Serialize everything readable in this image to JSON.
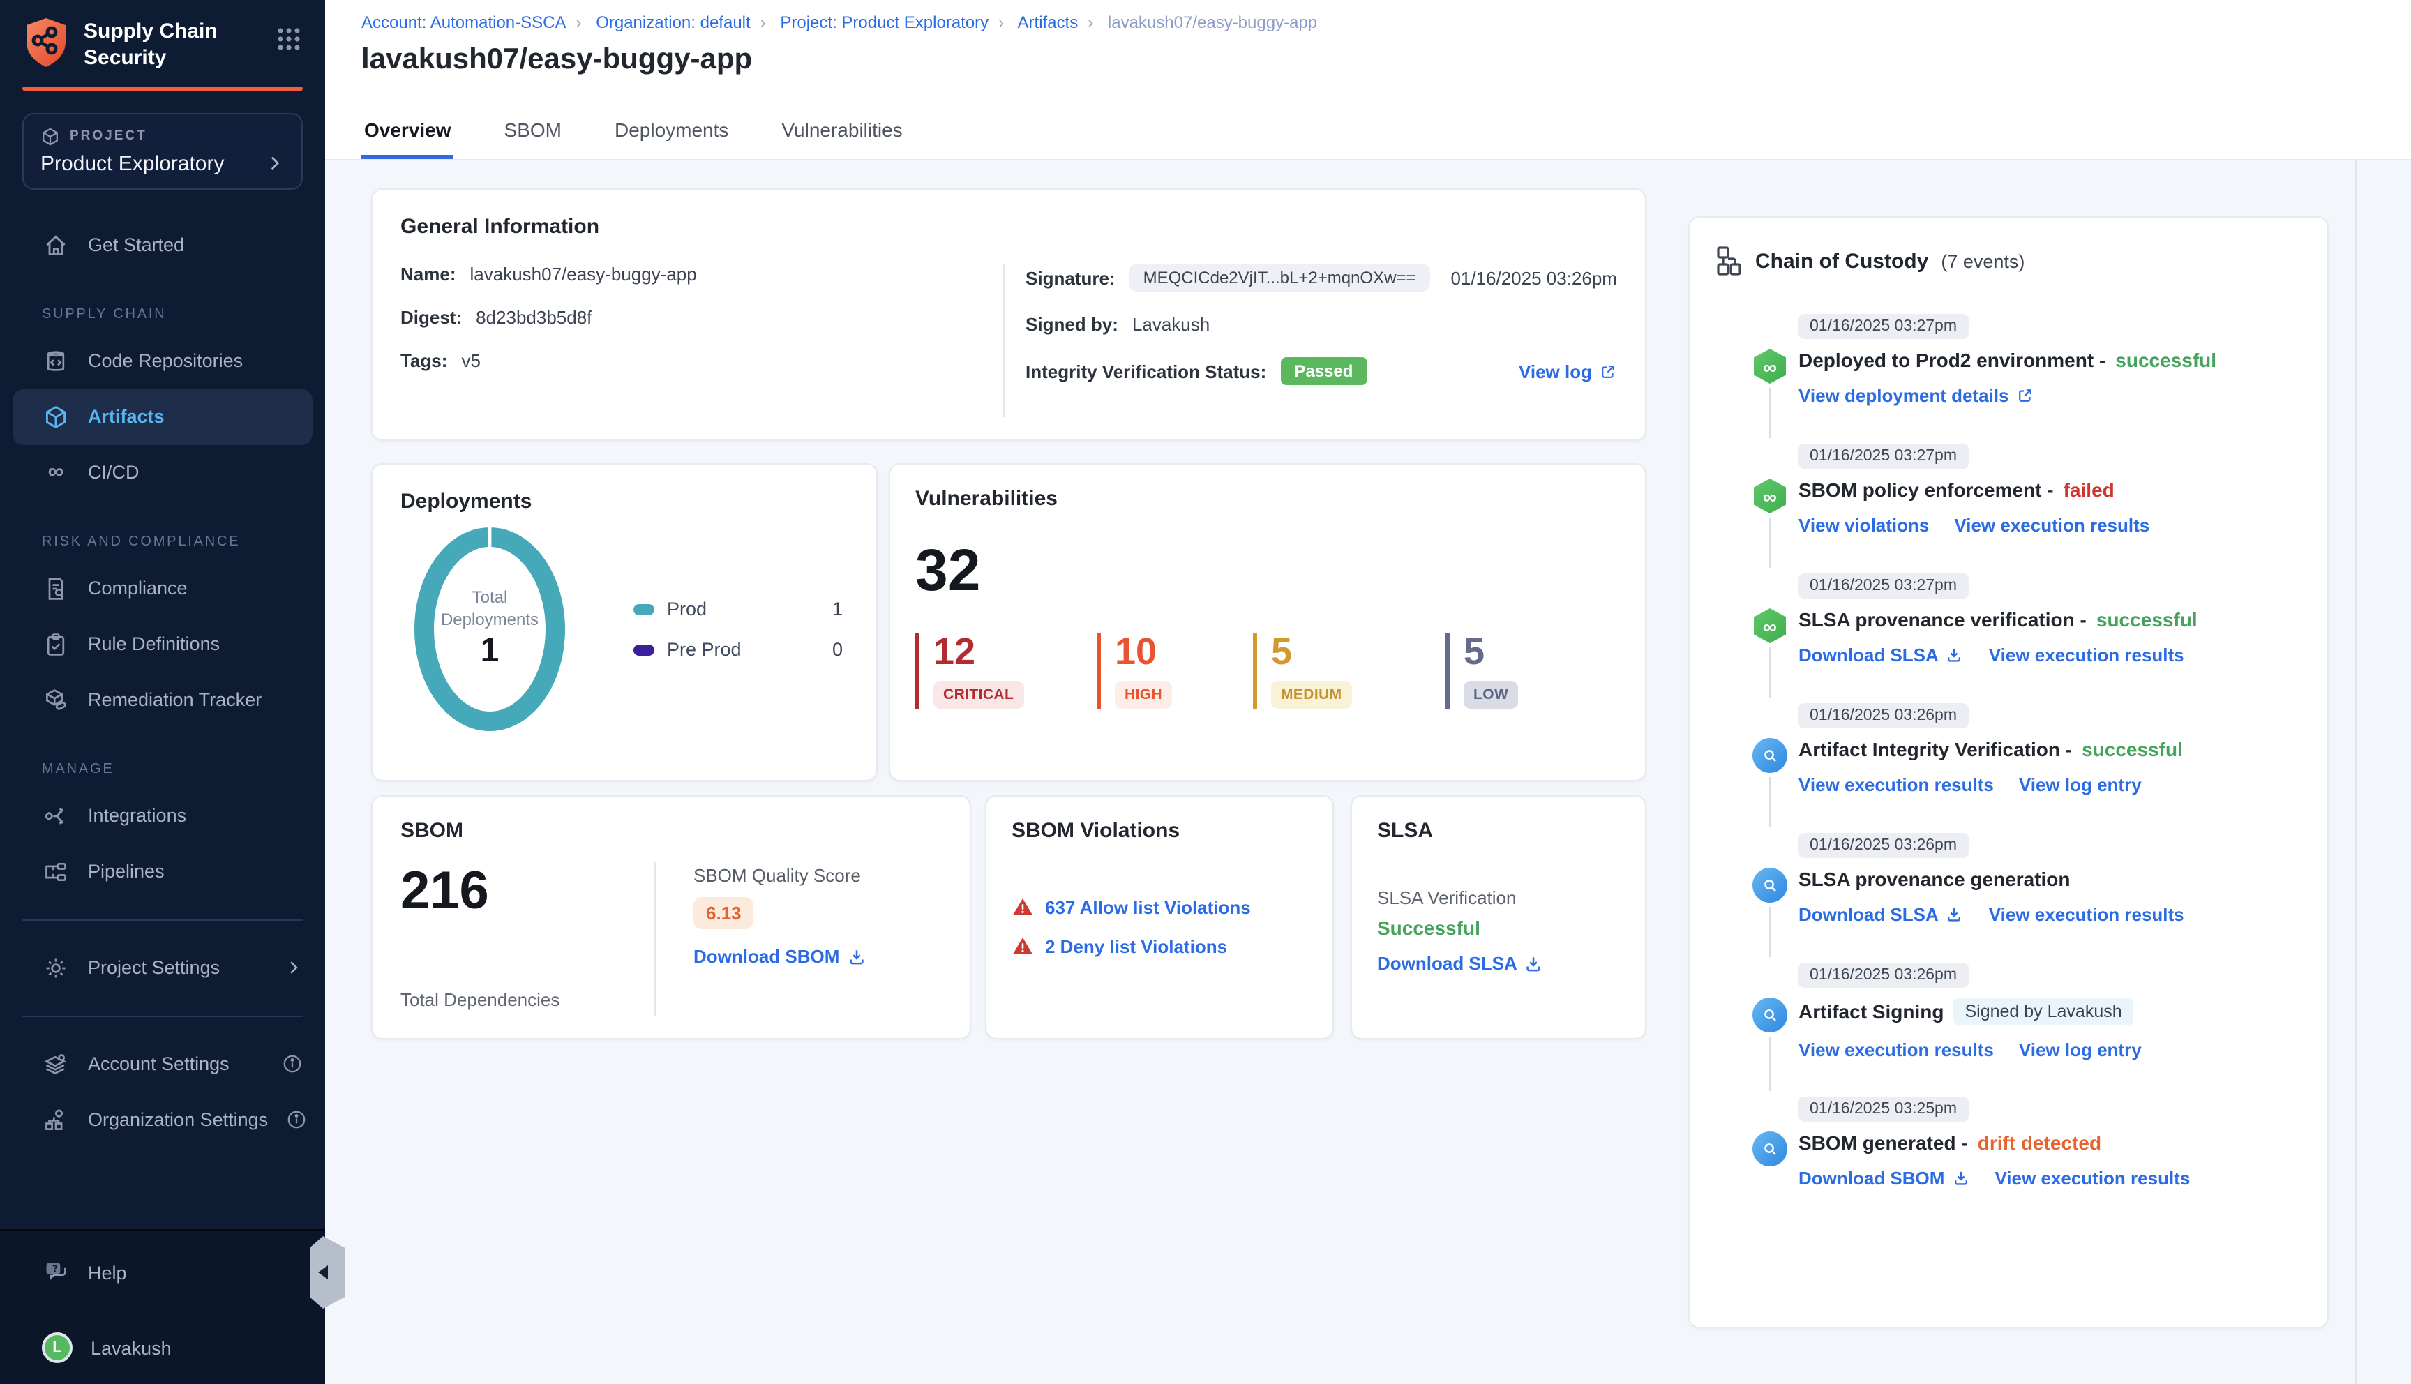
{
  "brand": {
    "title": "Supply Chain Security",
    "accent_color": "#f25c3f"
  },
  "sidebar": {
    "project": {
      "label": "PROJECT",
      "name": "Product Exploratory"
    },
    "get_started": "Get Started",
    "sections": [
      {
        "label": "SUPPLY CHAIN",
        "items": [
          {
            "label": "Code Repositories"
          },
          {
            "label": "Artifacts",
            "active": true
          },
          {
            "label": "CI/CD"
          }
        ]
      },
      {
        "label": "RISK AND COMPLIANCE",
        "items": [
          {
            "label": "Compliance"
          },
          {
            "label": "Rule Definitions"
          },
          {
            "label": "Remediation Tracker"
          }
        ]
      },
      {
        "label": "MANAGE",
        "items": [
          {
            "label": "Integrations"
          },
          {
            "label": "Pipelines"
          }
        ]
      }
    ],
    "project_settings": "Project Settings",
    "account_settings": "Account Settings",
    "organization_settings": "Organization Settings",
    "help": "Help",
    "user": {
      "name": "Lavakush",
      "initial": "L"
    }
  },
  "header": {
    "breadcrumb": [
      {
        "label": "Account: Automation-SSCA"
      },
      {
        "label": "Organization: default"
      },
      {
        "label": "Project: Product Exploratory"
      },
      {
        "label": "Artifacts"
      },
      {
        "label": "lavakush07/easy-buggy-app"
      }
    ],
    "title": "lavakush07/easy-buggy-app",
    "tabs": [
      {
        "label": "Overview",
        "active": true
      },
      {
        "label": "SBOM"
      },
      {
        "label": "Deployments"
      },
      {
        "label": "Vulnerabilities"
      }
    ]
  },
  "general_info": {
    "title": "General Information",
    "name_label": "Name:",
    "name": "lavakush07/easy-buggy-app",
    "digest_label": "Digest:",
    "digest": "8d23bd3b5d8f",
    "tags_label": "Tags:",
    "tags": "v5",
    "signature_label": "Signature:",
    "signature": "MEQCICde2VjIT...bL+2+mqnOXw==",
    "signature_time": "01/16/2025 03:26pm",
    "signed_by_label": "Signed by:",
    "signed_by": "Lavakush",
    "integrity_label": "Integrity Verification Status:",
    "integrity_status": "Passed",
    "view_log": "View log"
  },
  "deployments": {
    "title": "Deployments",
    "donut": {
      "center_label_1": "Total",
      "center_label_2": "Deployments",
      "total": "1",
      "color": "#45a9ba"
    },
    "legend": [
      {
        "label": "Prod",
        "value": "1",
        "color": "#45a9ba"
      },
      {
        "label": "Pre Prod",
        "value": "0",
        "color": "#3c1f9b"
      }
    ]
  },
  "vulnerabilities": {
    "title": "Vulnerabilities",
    "total": "32",
    "severities": [
      {
        "label": "CRITICAL",
        "count": "12",
        "color": "#b32b2e"
      },
      {
        "label": "HIGH",
        "count": "10",
        "color": "#e8542f"
      },
      {
        "label": "MEDIUM",
        "count": "5",
        "color": "#d29a2e"
      },
      {
        "label": "LOW",
        "count": "5",
        "color": "#646c8a"
      }
    ]
  },
  "sbom": {
    "title": "SBOM",
    "total": "216",
    "total_label": "Total Dependencies",
    "quality_label": "SBOM Quality Score",
    "quality_score": "6.13",
    "download": "Download SBOM"
  },
  "sbom_violations": {
    "title": "SBOM Violations",
    "rows": [
      {
        "label": "637 Allow list Violations"
      },
      {
        "label": "2 Deny list Violations"
      }
    ]
  },
  "slsa": {
    "title": "SLSA",
    "verification_label": "SLSA Verification",
    "verification_status": "Successful",
    "download": "Download SLSA"
  },
  "chain": {
    "title": "Chain of Custody",
    "count": "(7 events)",
    "events": [
      {
        "timestamp": "01/16/2025 03:27pm",
        "title": "Deployed to Prod2 environment -",
        "status": "successful",
        "links": [
          {
            "label": "View deployment details"
          }
        ]
      },
      {
        "timestamp": "01/16/2025 03:27pm",
        "title": "SBOM policy enforcement -",
        "status": "failed",
        "links": [
          {
            "label": "View violations"
          },
          {
            "label": "View execution results"
          }
        ]
      },
      {
        "timestamp": "01/16/2025 03:27pm",
        "title": "SLSA provenance verification -",
        "status": "successful",
        "links": [
          {
            "label": "Download SLSA"
          },
          {
            "label": "View execution results"
          }
        ]
      },
      {
        "timestamp": "01/16/2025 03:26pm",
        "title": "Artifact Integrity Verification -",
        "status": "successful",
        "links": [
          {
            "label": "View execution results"
          },
          {
            "label": "View log entry"
          }
        ]
      },
      {
        "timestamp": "01/16/2025 03:26pm",
        "title": "SLSA provenance generation",
        "links": [
          {
            "label": "Download SLSA"
          },
          {
            "label": "View execution results"
          }
        ]
      },
      {
        "timestamp": "01/16/2025 03:26pm",
        "title": "Artifact Signing",
        "badge": "Signed by Lavakush",
        "links": [
          {
            "label": "View execution results"
          },
          {
            "label": "View log entry"
          }
        ]
      },
      {
        "timestamp": "01/16/2025 03:25pm",
        "title": "SBOM generated -",
        "status": "drift detected",
        "links": [
          {
            "label": "Download SBOM"
          },
          {
            "label": "View execution results"
          }
        ]
      }
    ]
  }
}
